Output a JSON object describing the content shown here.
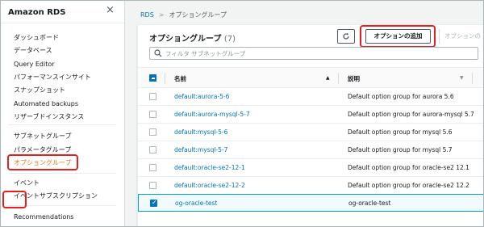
{
  "sidebar": {
    "title": "Amazon RDS",
    "close_icon": "×",
    "items": [
      {
        "label": "ダッシュボード"
      },
      {
        "label": "データベース"
      },
      {
        "label": "Query Editor"
      },
      {
        "label": "パフォーマンスインサイト"
      },
      {
        "label": "スナップショット"
      },
      {
        "label": "Automated backups"
      },
      {
        "label": "リザーブドインスタンス"
      },
      {
        "label": "サブネットグループ"
      },
      {
        "label": "パラメータグループ"
      },
      {
        "label": "オプショングループ"
      },
      {
        "label": "イベント"
      },
      {
        "label": "イベントサブスクリプション"
      },
      {
        "label": "Recommendations"
      }
    ],
    "active_index": 9
  },
  "breadcrumb": {
    "root": "RDS",
    "separator": ">",
    "current": "オプショングループ"
  },
  "panel": {
    "title": "オプショングループ",
    "count": "(7)",
    "refresh_icon": "refresh-icon",
    "add_button": "オプションの追加",
    "faded_button": "オプションの",
    "search_placeholder": "フィルタ サブネットグループ"
  },
  "table": {
    "columns": {
      "name": "名前",
      "name_sort": "▲",
      "description": "説明",
      "description_sort": "▼"
    },
    "rows": [
      {
        "name": "default:aurora-5-6",
        "description": "Default option group for aurora 5.6",
        "checked": false
      },
      {
        "name": "default:aurora-mysql-5-7",
        "description": "Default option group for aurora-mysql 5.7",
        "checked": false
      },
      {
        "name": "default:mysql-5-6",
        "description": "Default option group for mysql 5.6",
        "checked": false
      },
      {
        "name": "default:mysql-5-7",
        "description": "Default option group for mysql 5.7",
        "checked": false
      },
      {
        "name": "default:oracle-se2-12-1",
        "description": "Default option group for oracle-se2 12.1",
        "checked": false
      },
      {
        "name": "default:oracle-se2-12-2",
        "description": "Default option group for oracle-se2 12.2",
        "checked": false
      },
      {
        "name": "og-oracle-test",
        "description": "og-oracle-test",
        "checked": true
      }
    ]
  },
  "colors": {
    "accent": "#ec7211",
    "link": "#0073bb",
    "highlight": "#e41f1f"
  }
}
